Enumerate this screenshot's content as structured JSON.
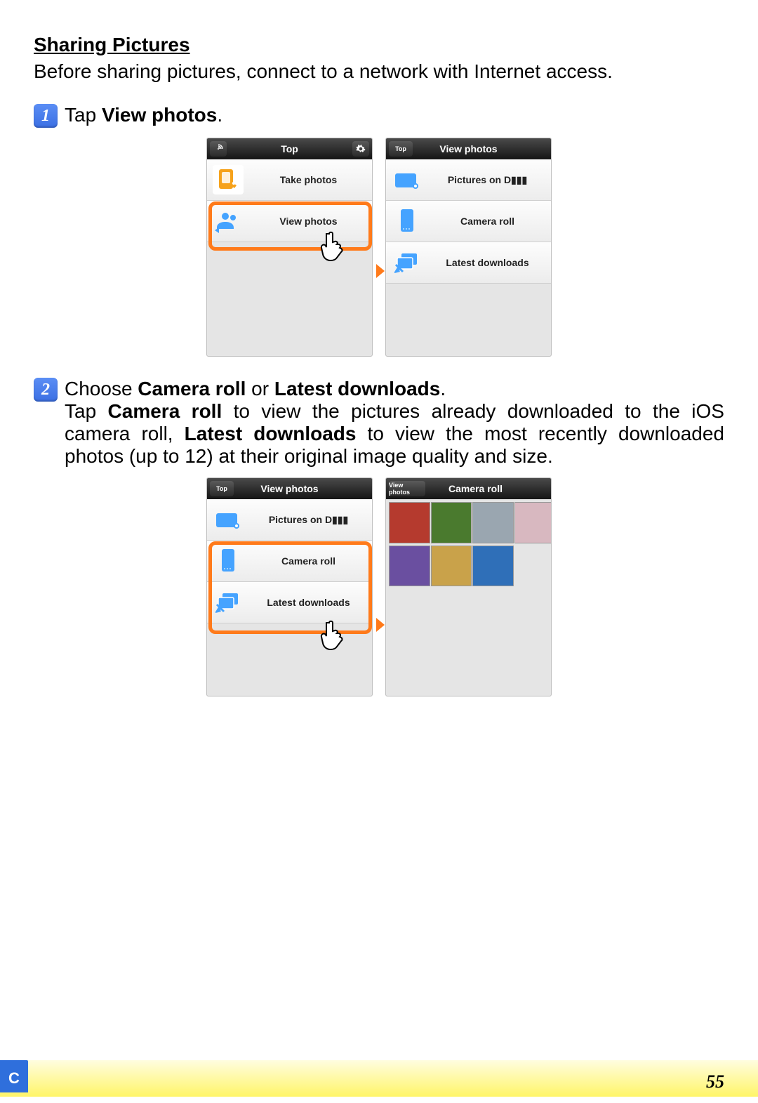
{
  "page": {
    "section_title": "Sharing Pictures",
    "intro": "Before sharing pictures, connect to a network with Internet access.",
    "footer_tab": "C",
    "page_number": "55"
  },
  "steps": [
    {
      "num": "1",
      "title_prefix": "Tap ",
      "title_bold": "View photos",
      "title_suffix": ".",
      "body_parts": []
    },
    {
      "num": "2",
      "title_prefix": "Choose ",
      "title_bold": "Camera roll",
      "title_mid": " or ",
      "title_bold2": "Latest downloads",
      "title_suffix": ".",
      "body_prefix": "Tap ",
      "body_b1": "Camera roll",
      "body_mid1": " to view the pictures already downloaded to the iOS camera roll, ",
      "body_b2": "Latest downloads",
      "body_mid2": " to view the most recently downloaded photos (up to 12) at their original image quality and size."
    }
  ],
  "screens": {
    "s1a": {
      "header": "Top",
      "left_icon": "signal",
      "right_icon": "gear",
      "items": [
        {
          "icon": "take",
          "label": "Take photos"
        },
        {
          "icon": "people",
          "label": "View photos"
        }
      ]
    },
    "s1b": {
      "header": "View photos",
      "left_label": "Top",
      "items": [
        {
          "icon": "folder",
          "label": "Pictures on D▮▮▮"
        },
        {
          "icon": "phone",
          "label": "Camera roll"
        },
        {
          "icon": "download",
          "label": "Latest downloads"
        }
      ]
    },
    "s2a": {
      "header": "View photos",
      "left_label": "Top",
      "items": [
        {
          "icon": "folder",
          "label": "Pictures on D▮▮▮"
        },
        {
          "icon": "phone",
          "label": "Camera roll"
        },
        {
          "icon": "download",
          "label": "Latest downloads"
        }
      ]
    },
    "s2b": {
      "header": "Camera roll",
      "left_label": "View photos",
      "thumb_colors": [
        "#b53a2e",
        "#4a7a2e",
        "#9aa6b0",
        "#d8b8c0",
        "#6a4fa0",
        "#c9a24a",
        "#2f6fb8"
      ]
    }
  }
}
